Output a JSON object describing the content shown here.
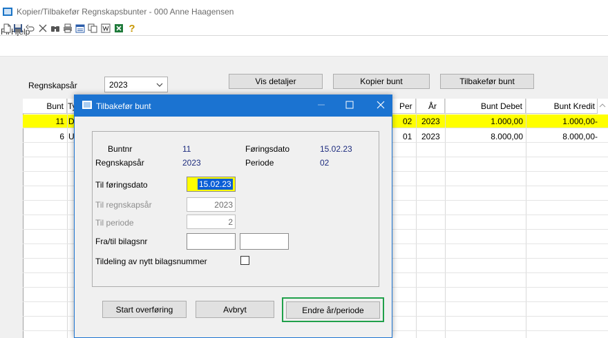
{
  "window": {
    "title": "Kopier/Tilbakefør Regnskapsbunter - 000 Anne Haagensen"
  },
  "menu": {
    "items": [
      "Fil",
      "Hjelp"
    ]
  },
  "toolbar": {
    "icons": [
      "new-document-icon",
      "save-icon",
      "undo-icon",
      "delete-icon",
      "find-icon",
      "print-icon",
      "calendar-icon",
      "copy-icon",
      "word-icon",
      "excel-icon",
      "help-icon"
    ],
    "help_glyph": "?"
  },
  "filter": {
    "year_label": "Regnskapsår",
    "year_value": "2023",
    "vis_detaljer": "Vis detaljer",
    "kopier_bunt": "Kopier bunt",
    "tilbakefor_bunt": "Tilbakefør bunt"
  },
  "grid": {
    "headers": {
      "bunt": "Bunt",
      "type": "Ty",
      "per": "Per",
      "ar": "År",
      "bunt_debet": "Bunt Debet",
      "bunt_kredit": "Bunt Kredit"
    },
    "rows": [
      {
        "bunt": "11",
        "type": "D",
        "per": "02",
        "ar": "2023",
        "debet": "1.000,00",
        "kredit": "1.000,00-"
      },
      {
        "bunt": "6",
        "type": "U",
        "per": "01",
        "ar": "2023",
        "debet": "8.000,00",
        "kredit": "8.000,00-"
      }
    ],
    "highlight_color": "#ffff00"
  },
  "dialog": {
    "title": "Tilbakefør bunt",
    "buntnr_label": "Buntnr",
    "buntnr_value": "11",
    "foringsdato_label": "Føringsdato",
    "foringsdato_value": "15.02.23",
    "regnskapsar_label": "Regnskapsår",
    "regnskapsar_value": "2023",
    "periode_label": "Periode",
    "periode_value": "02",
    "til_foringsdato_label": "Til føringsdato",
    "til_foringsdato_value": "15.02.23",
    "til_regnskapsar_label": "Til regnskapsår",
    "til_regnskapsar_value": "2023",
    "til_periode_label": "Til periode",
    "til_periode_value": "2",
    "fra_til_bilagsnr_label": "Fra/til bilagsnr",
    "fra_bilagsnr_value": "",
    "til_bilagsnr_value": "",
    "tildeling_label": "Tildeling av nytt bilagsnummer",
    "tildeling_checked": false,
    "btn_start": "Start overføring",
    "btn_avbryt": "Avbryt",
    "btn_endre": "Endre år/periode",
    "accent_color": "#1b73d1",
    "focus_color": "#20a04a"
  }
}
